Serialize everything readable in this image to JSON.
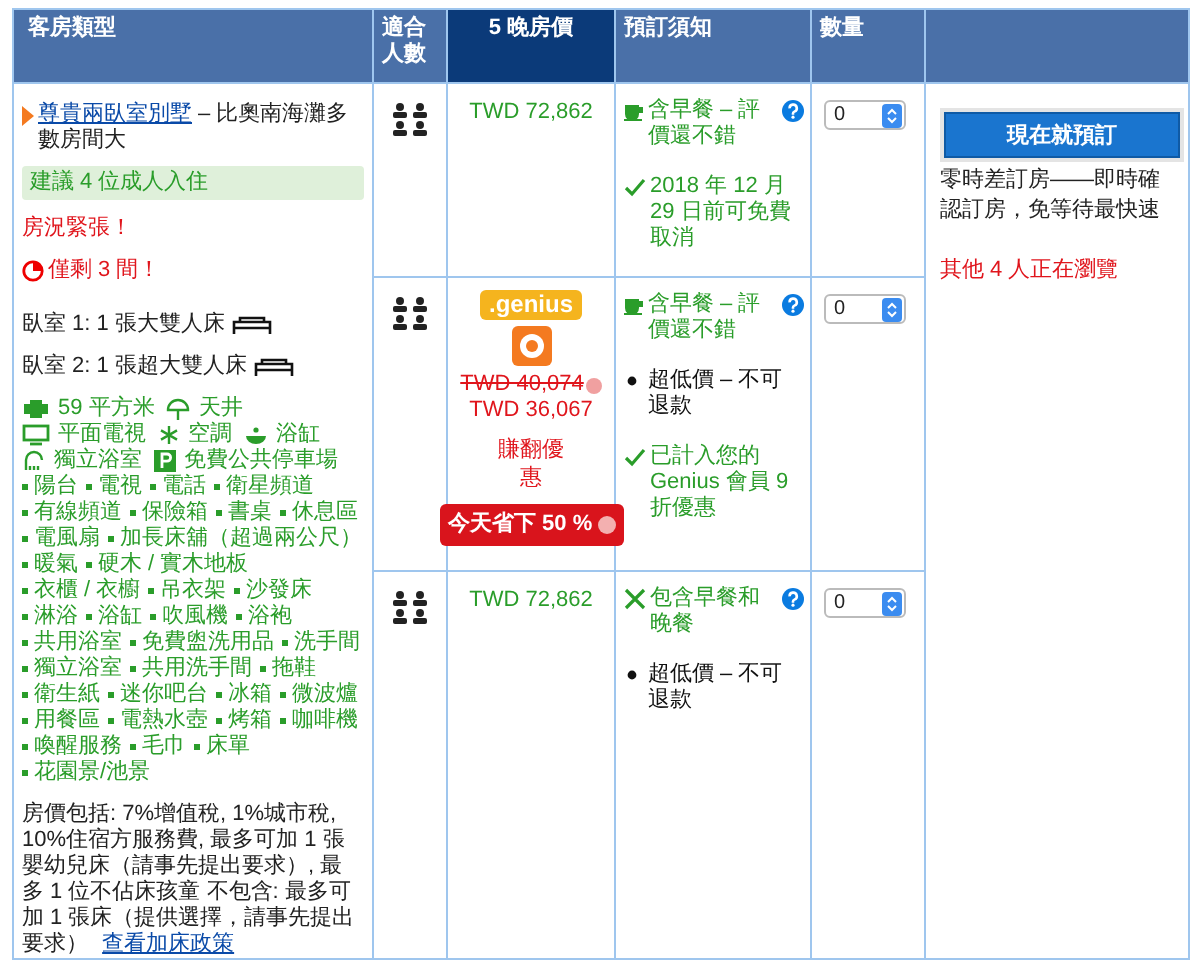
{
  "columns": [
    {
      "label": "客房類型",
      "selected": false
    },
    {
      "label": "適合人數",
      "selected": false
    },
    {
      "label": "5 晚房價",
      "selected": true
    },
    {
      "label": "預訂須知",
      "selected": false
    },
    {
      "label": "數量",
      "selected": false
    }
  ],
  "room": {
    "name": "尊貴兩臥室別墅",
    "size_note": "– 比奧南海灘多數房間大",
    "recommend": "建議 4 位成人入住",
    "scarcity": "房況緊張！",
    "remaining": "僅剩 3 間！",
    "beds": [
      "臥室 1: 1 張大雙人床",
      "臥室 2: 1 張超大雙人床"
    ],
    "facilities": [
      {
        "kind": "size",
        "label": "59 平方米"
      },
      {
        "kind": "view",
        "label": "天井"
      },
      {
        "kind": "tv",
        "label": "平面電視"
      },
      {
        "kind": "ac",
        "label": "空調"
      },
      {
        "kind": "bath",
        "label": "浴缸"
      },
      {
        "kind": "shower",
        "label": "獨立浴室"
      },
      {
        "kind": "parking",
        "label": "免費公共停車場"
      }
    ],
    "amenities": [
      "陽台",
      "電視",
      "電話",
      "衛星頻道",
      "有線頻道",
      "保險箱",
      "書桌",
      "休息區",
      "電風扇",
      "加長床舖（超過兩公尺）",
      "暖氣",
      "硬木 / 實木地板",
      "衣櫃 / 衣櫥",
      "吊衣架",
      "沙發床",
      "淋浴",
      "浴缸",
      "吹風機",
      "浴袍",
      "共用浴室",
      "免費盥洗用品",
      "洗手間",
      "獨立浴室",
      "共用洗手間",
      "拖鞋",
      "衛生紙",
      "迷你吧台",
      "冰箱",
      "微波爐",
      "用餐區",
      "電熱水壺",
      "烤箱",
      "咖啡機",
      "喚醒服務",
      "毛巾",
      "床單",
      "花園景/池景"
    ],
    "price_note": "房價包括: 7%增值稅, 1%城市稅, 10%住宿方服務費, 最多可加 1 張嬰幼兒床（請事先提出要求）, 最多 1 位不佔床孩童 不包含: 最多可加 1 張床（提供選擇，請事先提出要求）",
    "policy_link": "查看加床政策"
  },
  "offers": [
    {
      "price": "TWD 72,862",
      "policies": [
        {
          "kind": "breakfast",
          "text": "含早餐 – 評價還不錯",
          "help": true
        },
        {
          "kind": "cancel",
          "text": "2018 年 12 月 29 日前可免費取消",
          "help": false
        }
      ],
      "quantity": "0"
    },
    {
      "price": "TWD 36,067",
      "genius": {
        "badge": ".genius",
        "old_price": "TWD 40,074",
        "deal": "賺翻優惠",
        "saving": "今天省下 50 %"
      },
      "policies": [
        {
          "kind": "breakfast",
          "text": "含早餐 – 評價還不錯",
          "help": true
        },
        {
          "kind": "nonrefundable",
          "text": "超低價 – 不可退款",
          "help": false
        },
        {
          "kind": "cancel",
          "text": "已計入您的 Genius 會員 9 折優惠",
          "help": false
        }
      ],
      "quantity": "0"
    },
    {
      "price": "TWD 72,862",
      "policies": [
        {
          "kind": "meal",
          "text": "包含早餐和晚餐",
          "help": true
        },
        {
          "kind": "nonrefundable",
          "text": "超低價 – 不可退款",
          "help": false
        }
      ],
      "quantity": "0"
    }
  ],
  "action": {
    "button": "現在就預訂",
    "note": "零時差訂房——即時確認訂房，免等待最快速",
    "viewers": "其他 4 人正在瀏覽"
  }
}
